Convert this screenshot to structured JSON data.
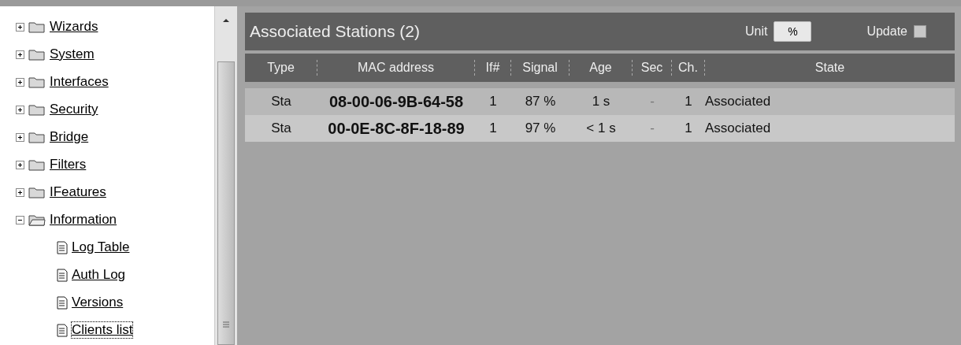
{
  "tree": [
    {
      "label": "Wizards",
      "expanded": false,
      "selected": false
    },
    {
      "label": "System",
      "expanded": false,
      "selected": false
    },
    {
      "label": "Interfaces",
      "expanded": false,
      "selected": false
    },
    {
      "label": "Security",
      "expanded": false,
      "selected": false
    },
    {
      "label": "Bridge",
      "expanded": false,
      "selected": false
    },
    {
      "label": "Filters",
      "expanded": false,
      "selected": false
    },
    {
      "label": "IFeatures",
      "expanded": false,
      "selected": false
    },
    {
      "label": "Information",
      "expanded": true,
      "selected": false,
      "children": [
        {
          "label": "Log Table",
          "selected": false
        },
        {
          "label": "Auth Log",
          "selected": false
        },
        {
          "label": "Versions",
          "selected": false
        },
        {
          "label": "Clients list",
          "selected": true
        }
      ]
    }
  ],
  "panel": {
    "title": "Associated Stations (2)",
    "unit_label": "Unit",
    "unit_value": "%",
    "update_label": "Update",
    "update_checked": false
  },
  "table": {
    "columns": [
      "Type",
      "MAC address",
      "If#",
      "Signal",
      "Age",
      "Sec",
      "Ch.",
      "State"
    ],
    "rows": [
      [
        "Sta",
        "08-00-06-9B-64-58",
        "1",
        "87 %",
        "1 s",
        "-",
        "1",
        "Associated"
      ],
      [
        "Sta",
        "00-0E-8C-8F-18-89",
        "1",
        "97 %",
        "< 1 s",
        "-",
        "1",
        "Associated"
      ]
    ]
  }
}
